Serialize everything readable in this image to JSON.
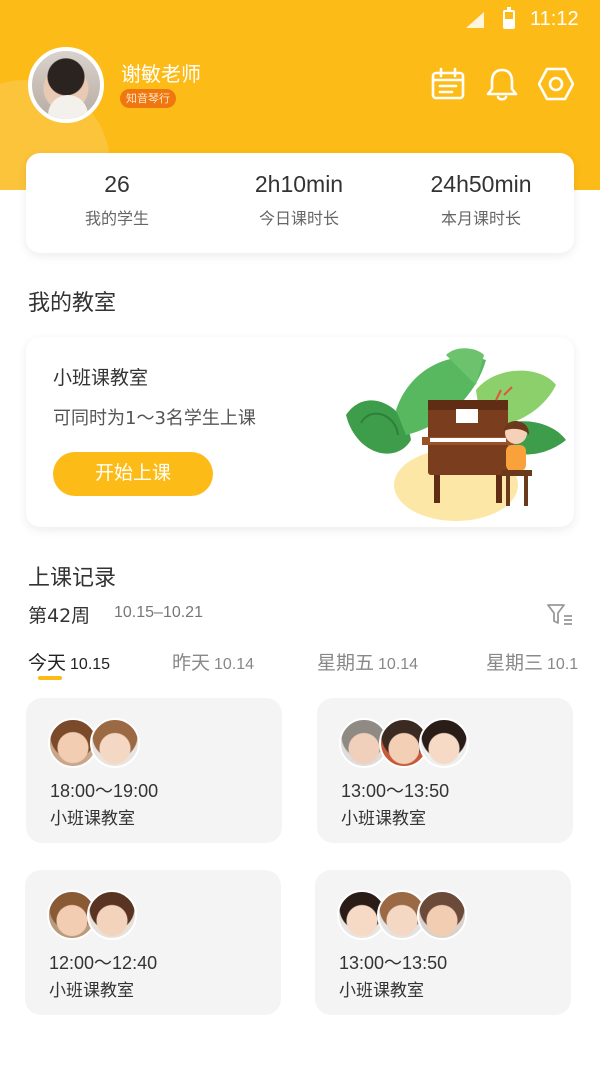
{
  "status_bar": {
    "time": "11:12"
  },
  "profile": {
    "name": "谢敏老师",
    "tag": "知音琴行"
  },
  "header_icons": [
    "calendar-icon",
    "bell-icon",
    "settings-icon"
  ],
  "stats": [
    {
      "value": "26",
      "label": "我的学生"
    },
    {
      "value": "2h10min",
      "label": "今日课时长"
    },
    {
      "value": "24h50min",
      "label": "本月课时长"
    }
  ],
  "classroom_section": {
    "title": "我的教室",
    "card": {
      "title": "小班课教室",
      "description": "可同时为1～3名学生上课",
      "button": "开始上课"
    }
  },
  "records_section": {
    "title": "上课记录",
    "week_label": "第42周",
    "week_range": "10.15–10.21",
    "tabs": [
      {
        "day": "今天",
        "date": "10.15",
        "active": true
      },
      {
        "day": "昨天",
        "date": "10.14",
        "active": false
      },
      {
        "day": "星期五",
        "date": "10.14",
        "active": false
      },
      {
        "day": "星期三",
        "date": "10.1",
        "active": false
      }
    ],
    "records": [
      {
        "time": "18:00～19:00",
        "room": "小班课教室",
        "students": 2
      },
      {
        "time": "13:00～13:50",
        "room": "小班课教室",
        "students": 3
      },
      {
        "time": "12:00～12:40",
        "room": "小班课教室",
        "students": 2
      },
      {
        "time": "13:00～13:50",
        "room": "小班课教室",
        "students": 3
      }
    ]
  },
  "colors": {
    "primary": "#fdbb17",
    "tag": "#f0760f",
    "card_bg": "#f4f4f4"
  }
}
